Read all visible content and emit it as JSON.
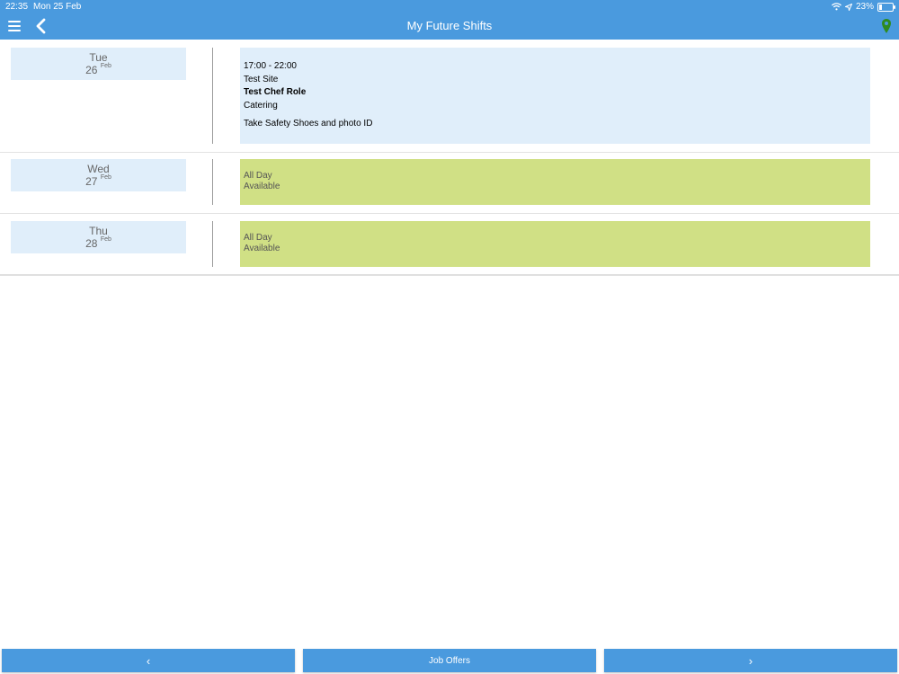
{
  "status_bar": {
    "time": "22:35",
    "date": "Mon 25 Feb",
    "battery": "23%",
    "battery_level": 0.23
  },
  "header": {
    "title": "My Future Shifts",
    "menu_icon": "hamburger-menu-icon",
    "back_icon": "chevron-left-icon",
    "location_icon": "location-pin-icon",
    "location_color": "#2e8b1f"
  },
  "colors": {
    "header_bg": "#4a9ade",
    "day_bg": "#e0eefa",
    "shift_bg": "#e0eefa",
    "available_bg": "#d0e085"
  },
  "days": [
    {
      "day": "Tue",
      "date": "26",
      "month": "Feb",
      "shift": {
        "time": "17:00 - 22:00",
        "site": "Test Site",
        "role": "Test Chef Role",
        "department": "Catering",
        "note": "Take Safety Shoes and photo ID"
      }
    },
    {
      "day": "Wed",
      "date": "27",
      "month": "Feb",
      "availability": {
        "period": "All Day",
        "status": "Available"
      }
    },
    {
      "day": "Thu",
      "date": "28",
      "month": "Feb",
      "availability": {
        "period": "All Day",
        "status": "Available"
      }
    }
  ],
  "footer": {
    "prev_label": "‹",
    "center_label": "Job Offers",
    "next_label": "›"
  }
}
